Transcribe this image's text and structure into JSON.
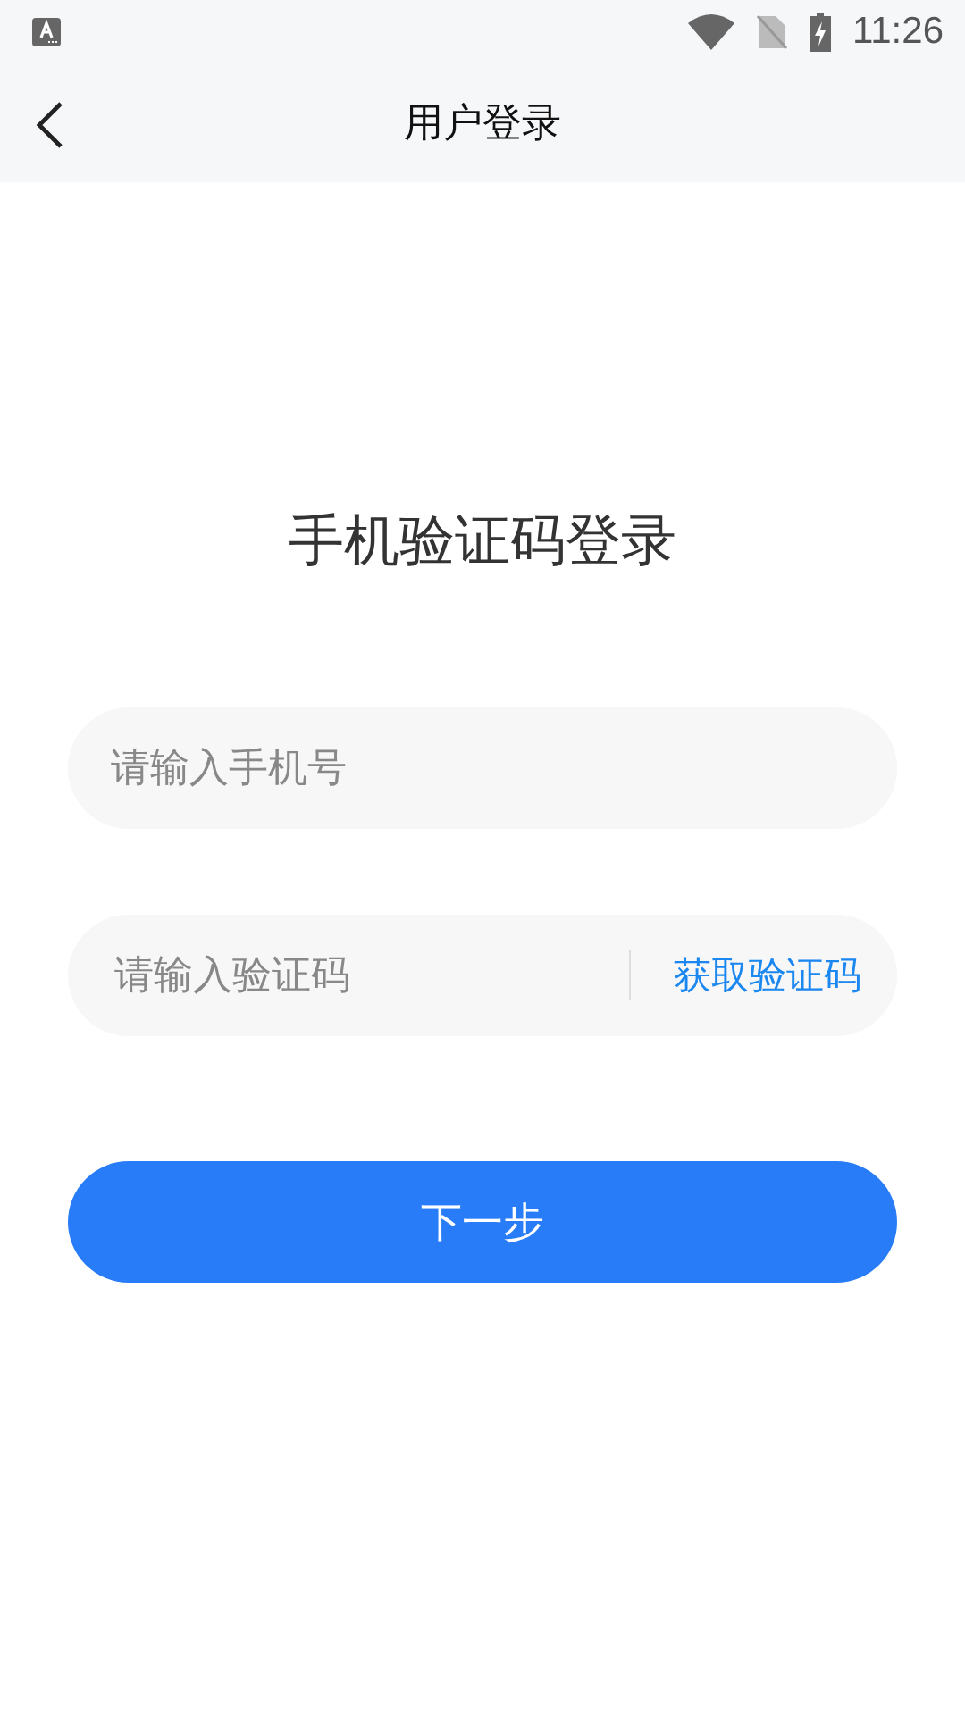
{
  "status_bar": {
    "time": "11:26"
  },
  "nav": {
    "title": "用户登录"
  },
  "heading": "手机验证码登录",
  "phone_field": {
    "placeholder": "请输入手机号"
  },
  "code_field": {
    "placeholder": "请输入验证码",
    "action": "获取验证码"
  },
  "submit": {
    "label": "下一步"
  }
}
